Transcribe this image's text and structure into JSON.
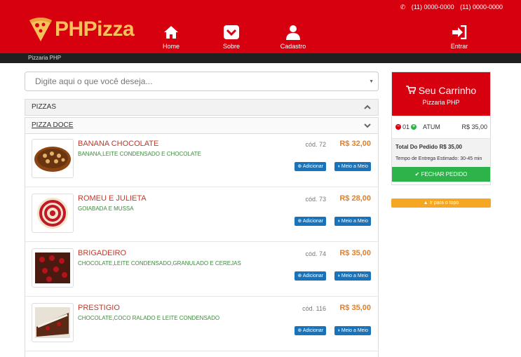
{
  "header": {
    "phones": [
      "(11) 0000-0000",
      "(11) 0000-0000"
    ],
    "brand": "PHPizza",
    "nav": [
      {
        "label": "Home",
        "icon": "home-icon"
      },
      {
        "label": "Sobre",
        "icon": "pocket-icon"
      },
      {
        "label": "Cadastro",
        "icon": "user-icon"
      },
      {
        "label": "Entrar",
        "icon": "sign-in-icon"
      }
    ],
    "subtitle": "Pizzaria PHP"
  },
  "search": {
    "placeholder": "Digite aqui o que você deseja..."
  },
  "categories": {
    "pizzas": "PIZZAS",
    "doce": "PIZZA DOCE"
  },
  "products": [
    {
      "name": "BANANA CHOCOLATE",
      "desc": "BANANA,LEITE CONDENSADO E CHOCOLATE",
      "code": "cód. 72",
      "price": "R$ 32,00"
    },
    {
      "name": "ROMEU E JULIETA",
      "desc": "GOIABADA E MUSSA",
      "code": "cód. 73",
      "price": "R$ 28,00"
    },
    {
      "name": "BRIGADEIRO",
      "desc": "CHOCOLATE,LEITE CONDENSADO,GRANULADO E CEREJAS",
      "code": "cód. 74",
      "price": "R$ 35,00"
    },
    {
      "name": "PRESTIGIO",
      "desc": "CHOCOLATE,COCO RALADO E LEITE CONDENSADO",
      "code": "cód. 116",
      "price": "R$ 35,00"
    }
  ],
  "buttons": {
    "add": "Adicionar",
    "half": "Meio a Meio"
  },
  "cart": {
    "title": "Seu Carrinho",
    "subtitle": "Pizzaria PHP",
    "item": {
      "qty": "01",
      "name": "ATUM",
      "price": "R$ 35,00"
    },
    "total": "Total Do Pedido R$ 35,00",
    "eta": "Tempo de Entrega Estimado: 30-45 min",
    "checkout": "FECHAR PEDIDO",
    "to_top": "Ir para o topo"
  },
  "colors": {
    "brand_red": "#d7000f",
    "price": "#e67e22",
    "button_blue": "#1a73b8",
    "checkout_green": "#2db34a"
  }
}
